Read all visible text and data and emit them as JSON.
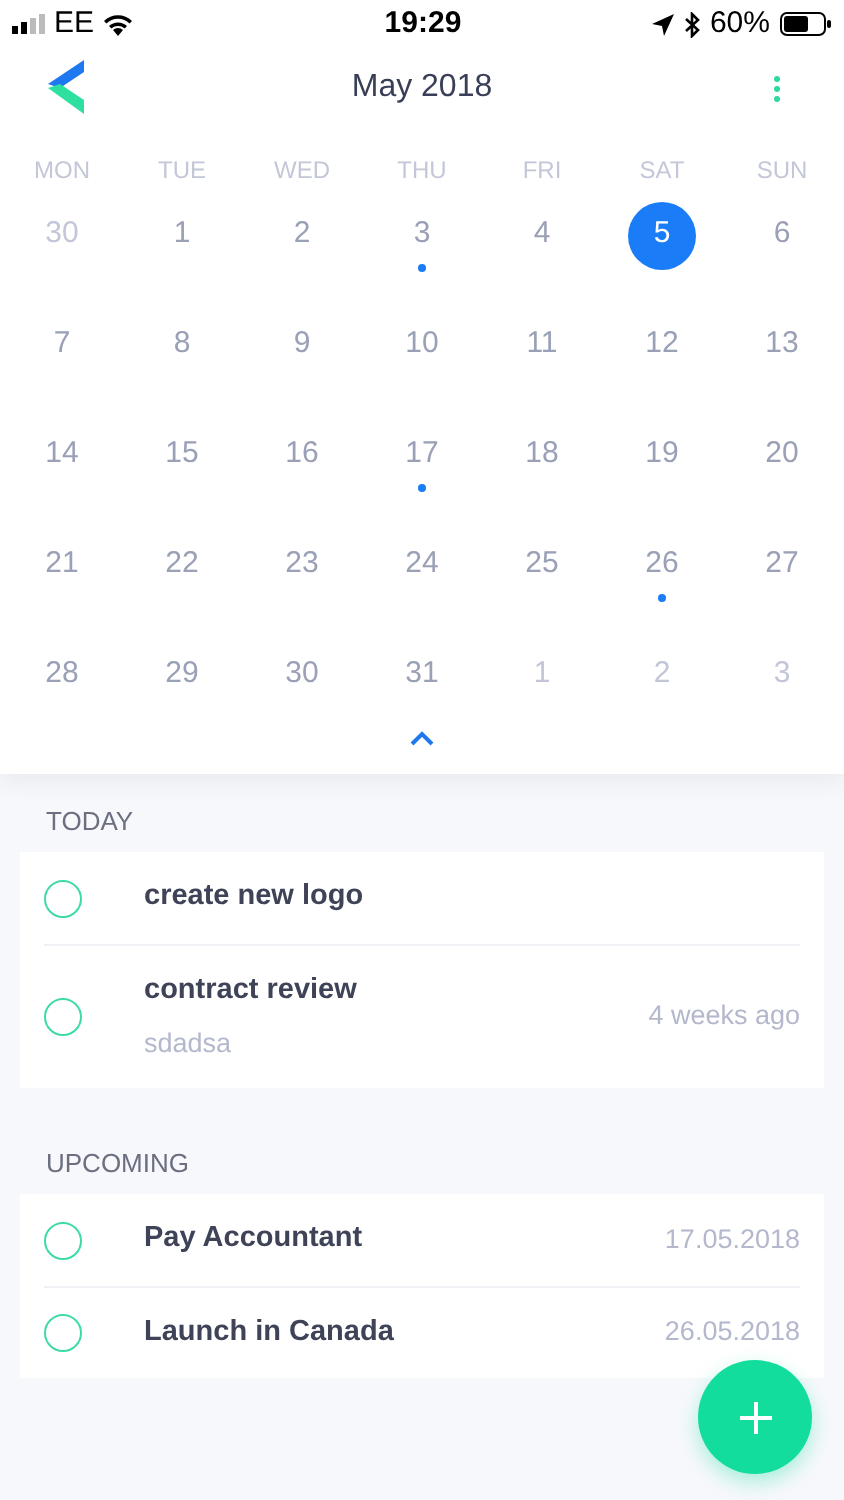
{
  "status_bar": {
    "carrier": "EE",
    "time": "19:29",
    "battery": "60%"
  },
  "header": {
    "title": "May 2018"
  },
  "calendar": {
    "weekdays": [
      "MON",
      "TUE",
      "WED",
      "THU",
      "FRI",
      "SAT",
      "SUN"
    ],
    "days": [
      {
        "label": "30",
        "in_month": false,
        "selected": false,
        "has_event": false
      },
      {
        "label": "1",
        "in_month": true,
        "selected": false,
        "has_event": false
      },
      {
        "label": "2",
        "in_month": true,
        "selected": false,
        "has_event": false
      },
      {
        "label": "3",
        "in_month": true,
        "selected": false,
        "has_event": true
      },
      {
        "label": "4",
        "in_month": true,
        "selected": false,
        "has_event": false
      },
      {
        "label": "5",
        "in_month": true,
        "selected": true,
        "has_event": false
      },
      {
        "label": "6",
        "in_month": true,
        "selected": false,
        "has_event": false
      },
      {
        "label": "7",
        "in_month": true,
        "selected": false,
        "has_event": false
      },
      {
        "label": "8",
        "in_month": true,
        "selected": false,
        "has_event": false
      },
      {
        "label": "9",
        "in_month": true,
        "selected": false,
        "has_event": false
      },
      {
        "label": "10",
        "in_month": true,
        "selected": false,
        "has_event": false
      },
      {
        "label": "11",
        "in_month": true,
        "selected": false,
        "has_event": false
      },
      {
        "label": "12",
        "in_month": true,
        "selected": false,
        "has_event": false
      },
      {
        "label": "13",
        "in_month": true,
        "selected": false,
        "has_event": false
      },
      {
        "label": "14",
        "in_month": true,
        "selected": false,
        "has_event": false
      },
      {
        "label": "15",
        "in_month": true,
        "selected": false,
        "has_event": false
      },
      {
        "label": "16",
        "in_month": true,
        "selected": false,
        "has_event": false
      },
      {
        "label": "17",
        "in_month": true,
        "selected": false,
        "has_event": true
      },
      {
        "label": "18",
        "in_month": true,
        "selected": false,
        "has_event": false
      },
      {
        "label": "19",
        "in_month": true,
        "selected": false,
        "has_event": false
      },
      {
        "label": "20",
        "in_month": true,
        "selected": false,
        "has_event": false
      },
      {
        "label": "21",
        "in_month": true,
        "selected": false,
        "has_event": false
      },
      {
        "label": "22",
        "in_month": true,
        "selected": false,
        "has_event": false
      },
      {
        "label": "23",
        "in_month": true,
        "selected": false,
        "has_event": false
      },
      {
        "label": "24",
        "in_month": true,
        "selected": false,
        "has_event": false
      },
      {
        "label": "25",
        "in_month": true,
        "selected": false,
        "has_event": false
      },
      {
        "label": "26",
        "in_month": true,
        "selected": false,
        "has_event": true
      },
      {
        "label": "27",
        "in_month": true,
        "selected": false,
        "has_event": false
      },
      {
        "label": "28",
        "in_month": true,
        "selected": false,
        "has_event": false
      },
      {
        "label": "29",
        "in_month": true,
        "selected": false,
        "has_event": false
      },
      {
        "label": "30",
        "in_month": true,
        "selected": false,
        "has_event": false
      },
      {
        "label": "31",
        "in_month": true,
        "selected": false,
        "has_event": false
      },
      {
        "label": "1",
        "in_month": false,
        "selected": false,
        "has_event": false
      },
      {
        "label": "2",
        "in_month": false,
        "selected": false,
        "has_event": false
      },
      {
        "label": "3",
        "in_month": false,
        "selected": false,
        "has_event": false
      }
    ]
  },
  "sections": [
    {
      "title": "TODAY",
      "tasks": [
        {
          "title": "create new logo",
          "done": false
        },
        {
          "title": "contract review",
          "note": "sdadsa",
          "meta": "4 weeks ago",
          "done": false
        }
      ]
    },
    {
      "title": "UPCOMING",
      "tasks": [
        {
          "title": "Pay Accountant",
          "meta": "17.05.2018",
          "done": false
        },
        {
          "title": "Launch in Canada",
          "meta": "26.05.2018",
          "done": false
        }
      ]
    }
  ]
}
